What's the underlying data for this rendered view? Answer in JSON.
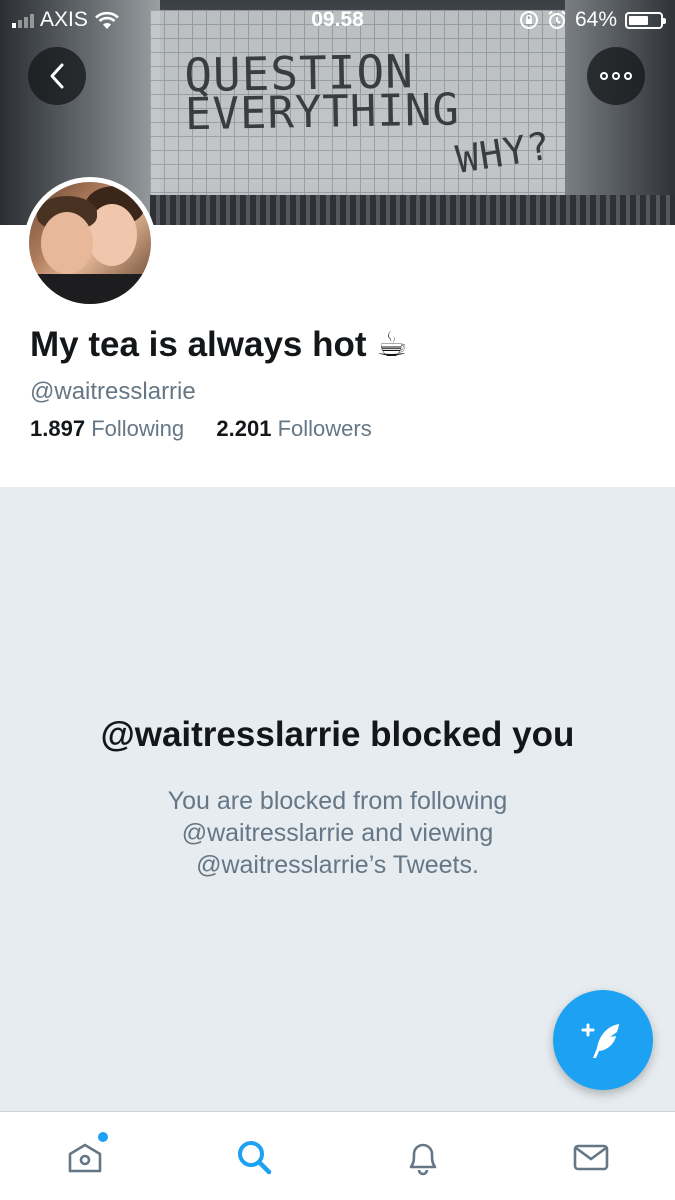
{
  "status_bar": {
    "carrier": "AXIS",
    "time": "09.58",
    "battery_percent": "64%",
    "battery_level": 0.64
  },
  "header": {
    "banner_text": [
      "QUESTION",
      "EVERYTHING",
      "WHY?"
    ],
    "back_icon": "chevron-left-icon",
    "more_icon": "more-options-icon"
  },
  "profile": {
    "display_name": "My tea is always hot ☕",
    "handle": "@waitresslarrie",
    "following_count": "1.897",
    "following_label": "Following",
    "followers_count": "2.201",
    "followers_label": "Followers"
  },
  "blocked": {
    "title": "@waitresslarrie blocked you",
    "message": "You are blocked from following @waitresslarrie and viewing @waitresslarrie’s Tweets."
  },
  "compose": {
    "icon": "compose-tweet-icon"
  },
  "tabbar": {
    "items": [
      {
        "name": "home",
        "icon": "home-icon",
        "has_badge": true
      },
      {
        "name": "search",
        "icon": "search-icon",
        "active": true
      },
      {
        "name": "notifications",
        "icon": "bell-icon"
      },
      {
        "name": "messages",
        "icon": "mail-icon"
      }
    ]
  },
  "colors": {
    "accent": "#1da1f2",
    "text_primary": "#14171a",
    "text_secondary": "#657786",
    "blocked_background": "#e6ecf0",
    "icon_inactive": "#657786"
  }
}
